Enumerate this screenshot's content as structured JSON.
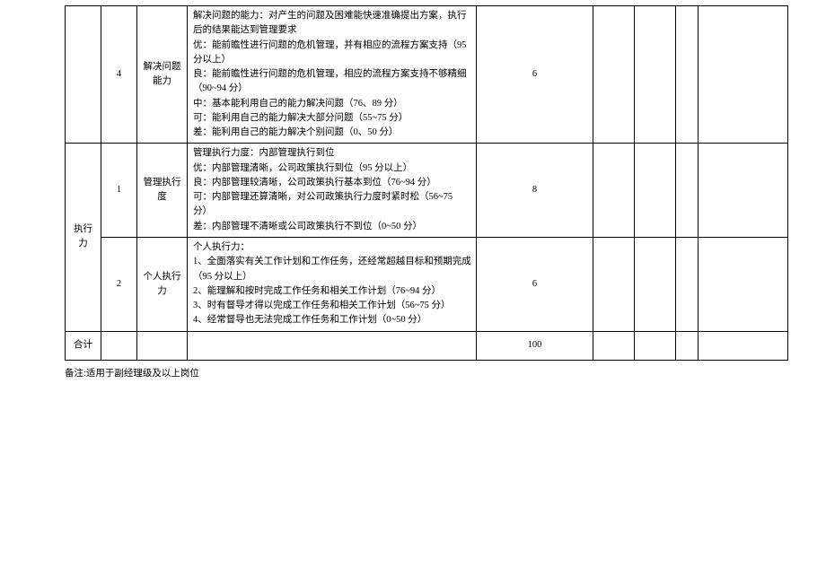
{
  "rows": {
    "r0": {
      "idx": "4",
      "item": "解决问题能力",
      "desc": "解决问题的能力：对产生的问题及困难能快速准确提出方案，执行后的结果能达到管理要求\n优：能前瞻性进行问题的危机管理，并有相应的流程方案支持（95 分以上）\n良：能前瞻性进行问题的危机管理，相应的流程方案支持不够精细（90~94 分）\n中：基本能利用自己的能力解决问题（76、89 分）\n可：能利用自己的能力解决大部分问题（55~75 分）\n差：能利用自己的能力解决个别问题（0、50 分）",
      "score": "6"
    },
    "r1": {
      "category": "执行力",
      "idx": "1",
      "item": "管理执行度",
      "desc": "管理执行力度：内部管理执行到位\n优：内部管理清晰，公司政策执行到位（95 分以上）\n良：内部管理较清晰，公司政策执行基本到位（76~94 分）\n可：内部管理还算清晰，对公司政策执行力度时紧时松（56~75 分）\n差：内部管理不清晰或公司政策执行不到位（0~50 分）",
      "score": "8"
    },
    "r2": {
      "idx": "2",
      "item": "个人执行力",
      "desc": "个人执行力：\n1、全面落实有关工作计划和工作任务，还经常超越目标和预期完成（95 分以上）\n2、能理解和按时完成工作任务和相关工作计划（76~94 分）\n3、时有督导才得以完成工作任务和相关工作计划（56~75 分）\n4、经常督导也无法完成工作任务和工作计划（0~50 分）",
      "score": "6"
    },
    "total": {
      "label": "合计",
      "value": "100"
    }
  },
  "footnote": "备注:适用于副经理级及以上岗位"
}
